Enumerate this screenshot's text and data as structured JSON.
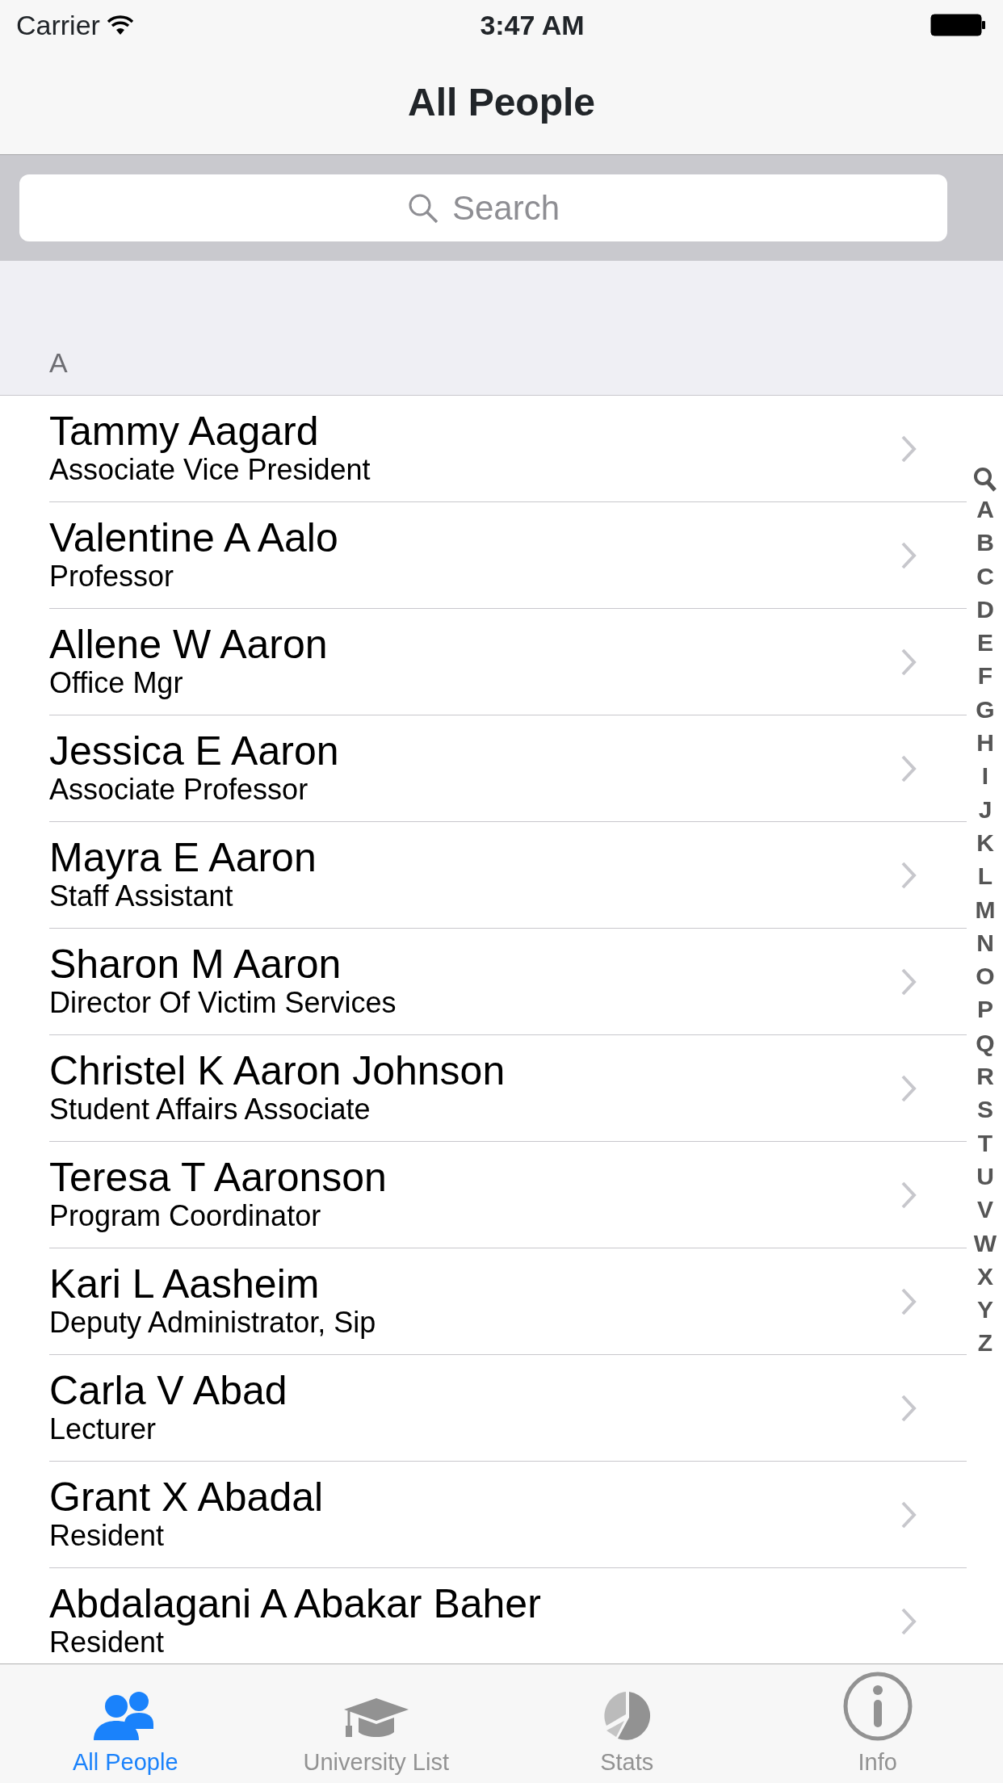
{
  "status_bar": {
    "carrier": "Carrier",
    "time": "3:47 AM"
  },
  "nav_bar": {
    "title": "All People"
  },
  "search": {
    "placeholder": "Search"
  },
  "section": {
    "header": "A"
  },
  "people": [
    {
      "name": "Tammy Aagard",
      "title": "Associate Vice President"
    },
    {
      "name": "Valentine A Aalo",
      "title": "Professor"
    },
    {
      "name": "Allene W Aaron",
      "title": "Office Mgr"
    },
    {
      "name": "Jessica E Aaron",
      "title": "Associate Professor"
    },
    {
      "name": "Mayra E Aaron",
      "title": "Staff Assistant"
    },
    {
      "name": "Sharon M Aaron",
      "title": "Director Of Victim Services"
    },
    {
      "name": "Christel K Aaron Johnson",
      "title": "Student Affairs Associate"
    },
    {
      "name": "Teresa T Aaronson",
      "title": "Program Coordinator"
    },
    {
      "name": "Kari L Aasheim",
      "title": "Deputy Administrator, Sip"
    },
    {
      "name": "Carla V Abad",
      "title": "Lecturer"
    },
    {
      "name": "Grant X Abadal",
      "title": "Resident"
    },
    {
      "name": "Abdalagani A Abakar Baher",
      "title": "Resident"
    }
  ],
  "section_index": [
    "A",
    "B",
    "C",
    "D",
    "E",
    "F",
    "G",
    "H",
    "I",
    "J",
    "K",
    "L",
    "M",
    "N",
    "O",
    "P",
    "Q",
    "R",
    "S",
    "T",
    "U",
    "V",
    "W",
    "X",
    "Y",
    "Z"
  ],
  "tabs": [
    {
      "kind": "people",
      "label": "All People",
      "selected": true
    },
    {
      "kind": "university",
      "label": "University List",
      "selected": false
    },
    {
      "kind": "stats",
      "label": "Stats",
      "selected": false
    },
    {
      "kind": "info",
      "label": "Info",
      "selected": false
    }
  ]
}
